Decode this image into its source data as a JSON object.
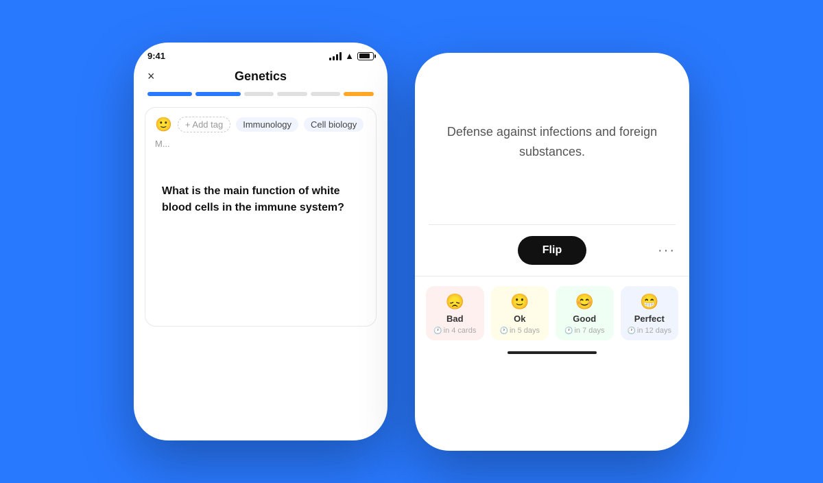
{
  "background_color": "#2979ff",
  "left_phone": {
    "status_time": "9:41",
    "header_title": "Genetics",
    "close_label": "×",
    "progress_segments": [
      {
        "type": "blue-active"
      },
      {
        "type": "blue-active"
      },
      {
        "type": "gray"
      },
      {
        "type": "gray"
      },
      {
        "type": "gray"
      },
      {
        "type": "orange"
      }
    ],
    "tags": {
      "add_tag_label": "+ Add tag",
      "items": [
        "Immunology",
        "Cell biology",
        "M..."
      ]
    },
    "question": "What is the main function of white blood cells in the immune system?"
  },
  "right_phone": {
    "answer": "Defense against infections and foreign substances.",
    "flip_button_label": "Flip",
    "more_label": "···",
    "ratings": [
      {
        "id": "bad",
        "emoji": "😞",
        "label": "Bad",
        "time_label": "in 4 cards",
        "bg": "bad"
      },
      {
        "id": "ok",
        "emoji": "🙂",
        "label": "Ok",
        "time_label": "in 5 days",
        "bg": "ok"
      },
      {
        "id": "good",
        "emoji": "😊",
        "label": "Good",
        "time_label": "in 7 days",
        "bg": "good"
      },
      {
        "id": "perfect",
        "emoji": "😁",
        "label": "Perfect",
        "time_label": "in 12 days",
        "bg": "perfect"
      }
    ]
  }
}
